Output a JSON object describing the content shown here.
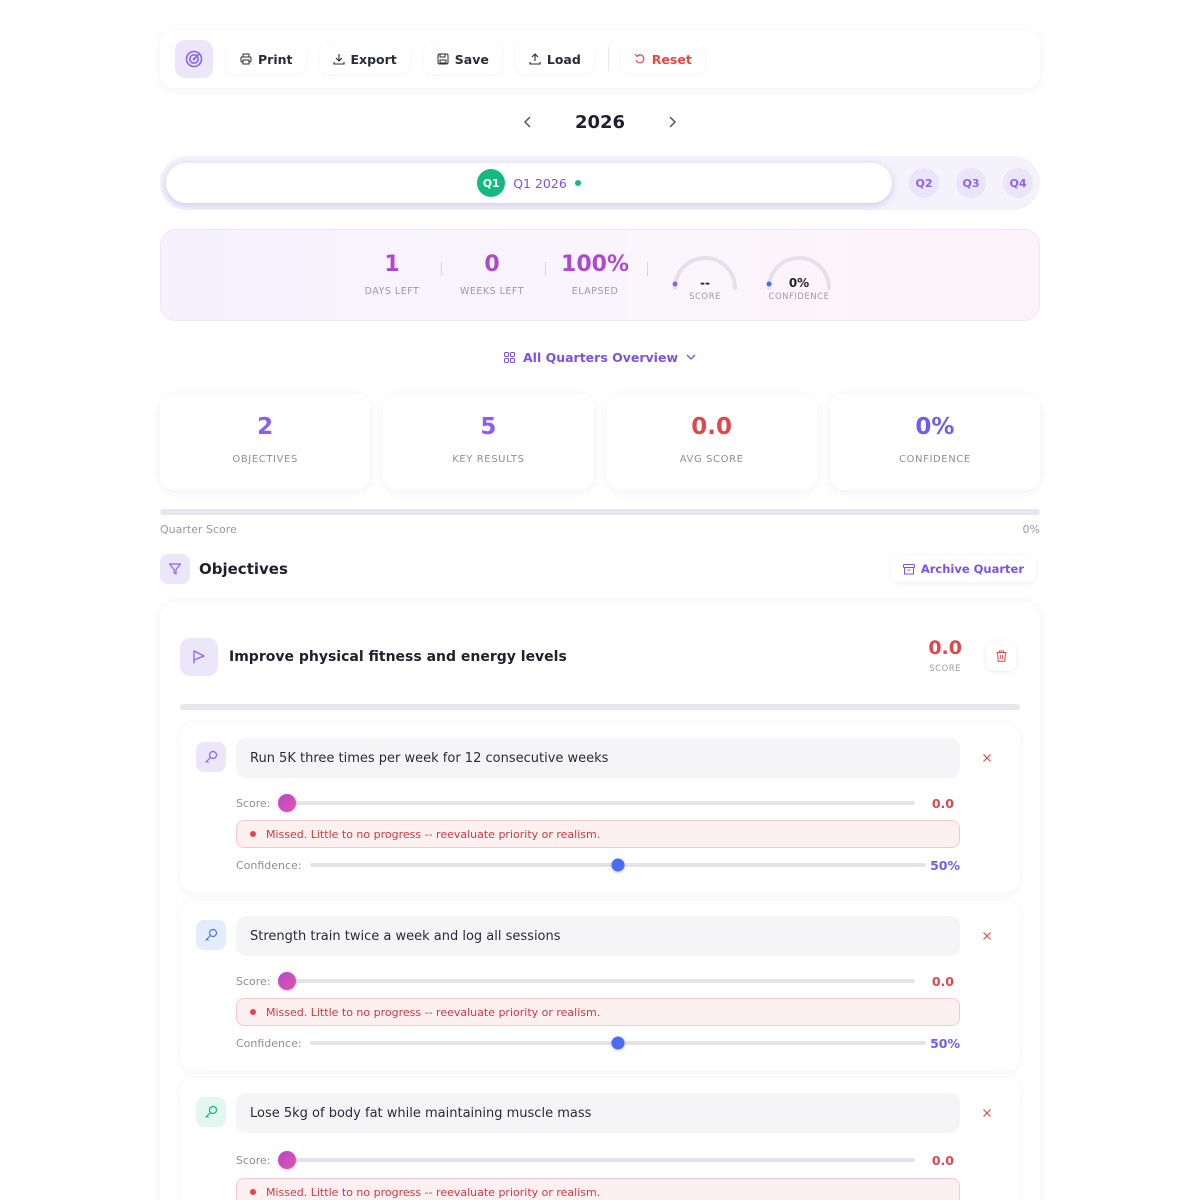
{
  "toolbar": {
    "print": "Print",
    "export": "Export",
    "save": "Save",
    "load": "Load",
    "reset": "Reset"
  },
  "year": "2026",
  "quarters": {
    "active_badge": "Q1",
    "active_label": "Q1 2026",
    "others": [
      "Q2",
      "Q3",
      "Q4"
    ]
  },
  "stats": {
    "days_left": "1",
    "days_left_label": "DAYS LEFT",
    "weeks_left": "0",
    "weeks_left_label": "WEEKS LEFT",
    "elapsed": "100%",
    "elapsed_label": "ELAPSED",
    "score_gauge": "--",
    "score_gauge_label": "SCORE",
    "confidence_gauge": "0%",
    "confidence_gauge_label": "CONFIDENCE"
  },
  "overview": {
    "label": "All Quarters Overview"
  },
  "summary": [
    {
      "value": "2",
      "label": "OBJECTIVES",
      "color": "#8b5cf6"
    },
    {
      "value": "5",
      "label": "KEY RESULTS",
      "color": "#8b5cf6"
    },
    {
      "value": "0.0",
      "label": "AVG SCORE",
      "color": "#e0474c"
    },
    {
      "value": "0%",
      "label": "CONFIDENCE",
      "color": "#6d5ef0"
    }
  ],
  "quarter_score": {
    "label": "Quarter Score",
    "value": "0%",
    "fraction": 0
  },
  "objectives_section": {
    "title": "Objectives",
    "archive_label": "Archive Quarter"
  },
  "objective": {
    "title": "Improve physical fitness and energy levels",
    "score": "0.0",
    "score_label": "SCORE",
    "progress": 0
  },
  "key_results": [
    {
      "text": "Run 5K three times per week for 12 consecutive weeks",
      "score_label": "Score:",
      "score": "0.0",
      "score_fraction": 0,
      "warning": "Missed. Little to no progress -- reevaluate priority or realism.",
      "confidence_label": "Confidence:",
      "confidence": "50%",
      "confidence_fraction": 0.5,
      "icon_bg": "#ece6fb",
      "icon_color": "#8b64e8"
    },
    {
      "text": "Strength train twice a week and log all sessions",
      "score_label": "Score:",
      "score": "0.0",
      "score_fraction": 0,
      "warning": "Missed. Little to no progress -- reevaluate priority or realism.",
      "confidence_label": "Confidence:",
      "confidence": "50%",
      "confidence_fraction": 0.5,
      "icon_bg": "#e3edfd",
      "icon_color": "#4a78e8"
    },
    {
      "text": "Lose 5kg of body fat while maintaining muscle mass",
      "score_label": "Score:",
      "score": "0.0",
      "score_fraction": 0,
      "warning": "Missed. Little to no progress -- reevaluate priority or realism.",
      "icon_bg": "#e2f7ef",
      "icon_color": "#12b981"
    }
  ],
  "colors": {
    "accent": "#7b52e6",
    "danger": "#e0474c",
    "success": "#12b981",
    "confidence": "#4a6cf0"
  }
}
